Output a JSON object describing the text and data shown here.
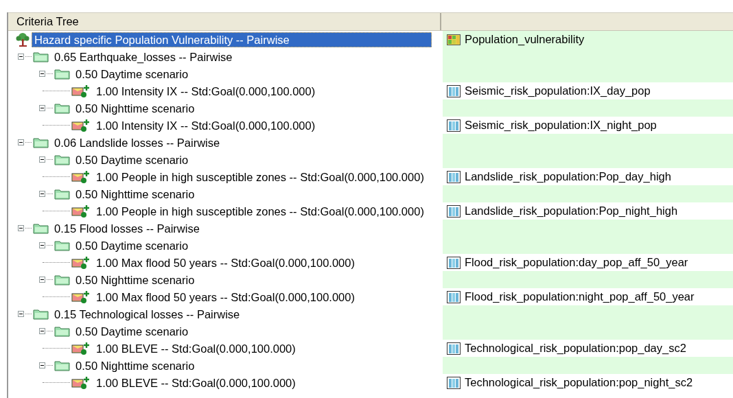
{
  "header": {
    "columns": [
      {
        "label": "Criteria Tree"
      }
    ]
  },
  "tree": [
    {
      "kind": "root",
      "label": "Hazard specific Population Vulnerability -- Pairwise",
      "selected": true,
      "layer": "Population_vulnerability",
      "children": [
        {
          "kind": "folder",
          "label": "0.65 Earthquake_losses -- Pairwise",
          "selected": false,
          "expanded": true,
          "children": [
            {
              "kind": "folder",
              "label": "0.50 Daytime scenario",
              "selected": false,
              "expanded": true,
              "children": [
                {
                  "kind": "leaf",
                  "label": "1.00 Intensity IX -- Std:Goal(0.000,100.000)",
                  "selected": false,
                  "layer": "Seismic_risk_population:IX_day_pop"
                }
              ]
            },
            {
              "kind": "folder",
              "label": "0.50 Nighttime scenario",
              "selected": false,
              "expanded": true,
              "children": [
                {
                  "kind": "leaf",
                  "label": "1.00 Intensity IX -- Std:Goal(0.000,100.000)",
                  "selected": false,
                  "layer": "Seismic_risk_population:IX_night_pop"
                }
              ]
            }
          ]
        },
        {
          "kind": "folder",
          "label": "0.06 Landslide losses -- Pairwise",
          "selected": false,
          "expanded": true,
          "children": [
            {
              "kind": "folder",
              "label": "0.50 Daytime scenario",
              "selected": false,
              "expanded": true,
              "children": [
                {
                  "kind": "leaf",
                  "label": "1.00 People in high susceptible zones -- Std:Goal(0.000,100.000)",
                  "selected": false,
                  "layer": "Landslide_risk_population:Pop_day_high"
                }
              ]
            },
            {
              "kind": "folder",
              "label": "0.50 Nighttime scenario",
              "selected": false,
              "expanded": true,
              "children": [
                {
                  "kind": "leaf",
                  "label": "1.00 People in high susceptible zones -- Std:Goal(0.000,100.000)",
                  "selected": false,
                  "layer": "Landslide_risk_population:Pop_night_high"
                }
              ]
            }
          ]
        },
        {
          "kind": "folder",
          "label": "0.15 Flood losses -- Pairwise",
          "selected": false,
          "expanded": true,
          "children": [
            {
              "kind": "folder",
              "label": "0.50 Daytime scenario",
              "selected": false,
              "expanded": true,
              "children": [
                {
                  "kind": "leaf",
                  "label": "1.00 Max flood 50 years -- Std:Goal(0.000,100.000)",
                  "selected": false,
                  "layer": "Flood_risk_population:day_pop_aff_50_year"
                }
              ]
            },
            {
              "kind": "folder",
              "label": "0.50 Nighttime scenario",
              "selected": false,
              "expanded": true,
              "children": [
                {
                  "kind": "leaf",
                  "label": "1.00 Max flood 50 years -- Std:Goal(0.000,100.000)",
                  "selected": false,
                  "layer": "Flood_risk_population:night_pop_aff_50_year"
                }
              ]
            }
          ]
        },
        {
          "kind": "folder",
          "label": "0.15 Technological losses -- Pairwise",
          "selected": false,
          "expanded": true,
          "children": [
            {
              "kind": "folder",
              "label": "0.50 Daytime scenario",
              "selected": false,
              "expanded": true,
              "children": [
                {
                  "kind": "leaf",
                  "label": "1.00 BLEVE -- Std:Goal(0.000,100.000)",
                  "selected": false,
                  "layer": "Technological_risk_population:pop_day_sc2"
                }
              ]
            },
            {
              "kind": "folder",
              "label": "0.50 Nighttime scenario",
              "selected": false,
              "expanded": true,
              "children": [
                {
                  "kind": "leaf",
                  "label": "1.00 BLEVE -- Std:Goal(0.000,100.000)",
                  "selected": false,
                  "layer": "Technological_risk_population:pop_night_sc2"
                }
              ]
            }
          ]
        }
      ]
    }
  ]
}
